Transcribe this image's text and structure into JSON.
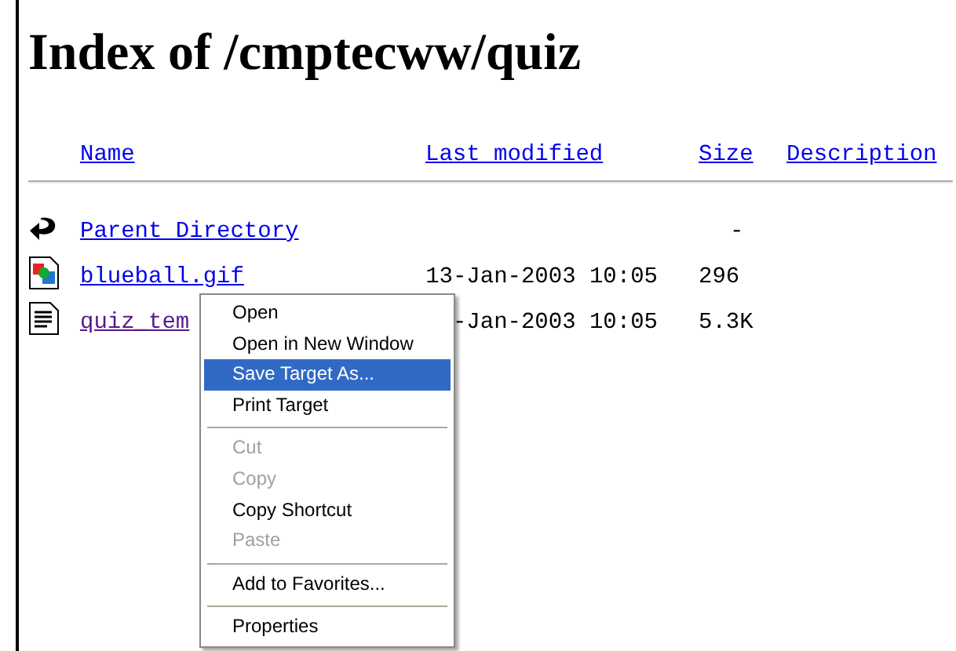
{
  "heading": "Index of /cmptecww/quiz",
  "columns": [
    {
      "label": "Name"
    },
    {
      "label": "Last modified"
    },
    {
      "label": "Size"
    },
    {
      "label": "Description"
    }
  ],
  "rows": [
    {
      "kind": "parent",
      "name": "Parent Directory",
      "visited": false,
      "modified": "",
      "size": "-"
    },
    {
      "kind": "image",
      "name": "blueball.gif",
      "visited": false,
      "modified": "13-Jan-2003 10:05",
      "size": "296"
    },
    {
      "kind": "text",
      "name": "quiz_tem",
      "visited": true,
      "modified": "-Jan-2003 10:05",
      "size": "5.3K"
    }
  ],
  "context_menu": [
    {
      "kind": "item",
      "label": "Open",
      "selected": false,
      "disabled": false
    },
    {
      "kind": "item",
      "label": "Open in New Window",
      "selected": false,
      "disabled": false
    },
    {
      "kind": "item",
      "label": "Save Target As...",
      "selected": true,
      "disabled": false
    },
    {
      "kind": "item",
      "label": "Print Target",
      "selected": false,
      "disabled": false
    },
    {
      "kind": "separator"
    },
    {
      "kind": "item",
      "label": "Cut",
      "selected": false,
      "disabled": true
    },
    {
      "kind": "item",
      "label": "Copy",
      "selected": false,
      "disabled": true
    },
    {
      "kind": "item",
      "label": "Copy Shortcut",
      "selected": false,
      "disabled": false
    },
    {
      "kind": "item",
      "label": "Paste",
      "selected": false,
      "disabled": true
    },
    {
      "kind": "separator"
    },
    {
      "kind": "item",
      "label": "Add to Favorites...",
      "selected": false,
      "disabled": false
    },
    {
      "kind": "separator"
    },
    {
      "kind": "item",
      "label": "Properties",
      "selected": false,
      "disabled": false
    }
  ]
}
